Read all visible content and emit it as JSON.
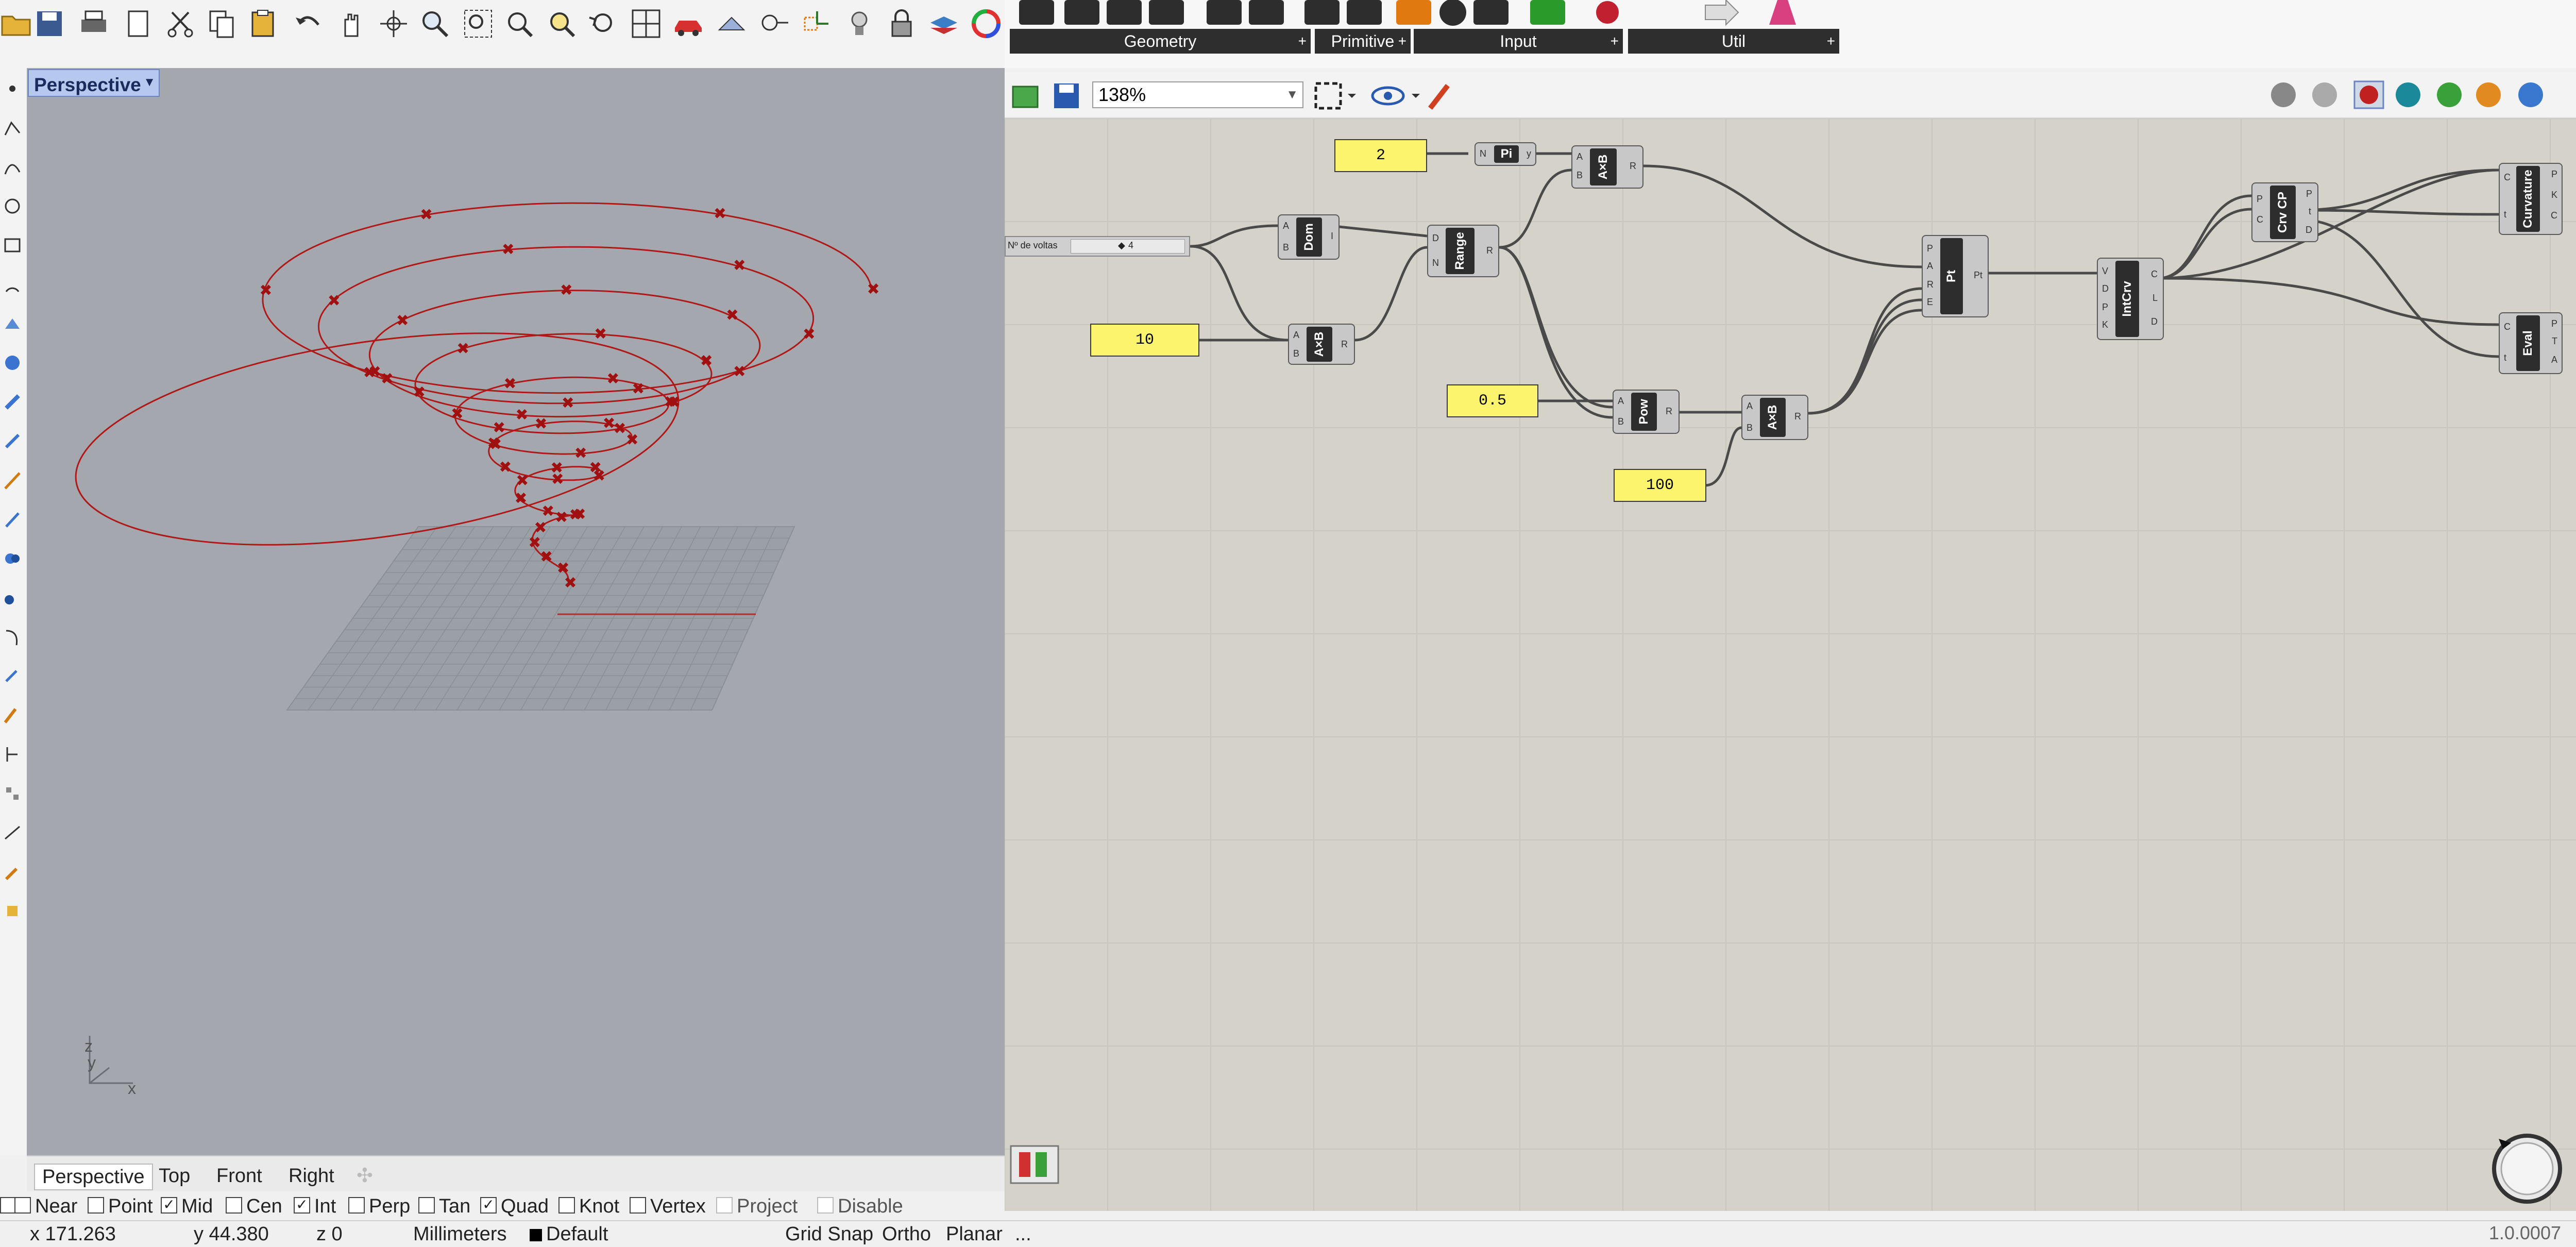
{
  "rhino": {
    "viewport": {
      "name": "Perspective",
      "axes": {
        "x": "x",
        "y": "y",
        "z": "z"
      }
    },
    "view_tabs": [
      {
        "label": "Perspective",
        "active": true
      },
      {
        "label": "Top"
      },
      {
        "label": "Front"
      },
      {
        "label": "Right"
      }
    ],
    "osnaps": [
      {
        "label": "Near",
        "checked": false
      },
      {
        "label": "Point",
        "checked": false
      },
      {
        "label": "Mid",
        "checked": true
      },
      {
        "label": "Cen",
        "checked": false
      },
      {
        "label": "Int",
        "checked": true
      },
      {
        "label": "Perp",
        "checked": false
      },
      {
        "label": "Tan",
        "checked": false
      },
      {
        "label": "Quad",
        "checked": true
      },
      {
        "label": "Knot",
        "checked": false
      },
      {
        "label": "Vertex",
        "checked": false
      },
      {
        "label": "Project",
        "checked": false
      },
      {
        "label": "Disable",
        "checked": false
      }
    ],
    "status": {
      "x": "x 171.263",
      "y": "y 44.380",
      "z": "z 0",
      "units": "Millimeters",
      "layer": "Default",
      "grid_snap": "Grid Snap",
      "ortho": "Ortho",
      "planar": "Planar"
    }
  },
  "grasshopper": {
    "ribbon_tabs": [
      "Geometry",
      "Primitive",
      "Input",
      "Util"
    ],
    "ribbon_tab_more": "+",
    "zoom": "138%",
    "canvas": {
      "slider": {
        "label": "Nº de voltas",
        "value": "4"
      },
      "panels": [
        "2",
        "10",
        "0.5",
        "100"
      ],
      "components": [
        {
          "name": "Pi",
          "inputs": [
            "N"
          ],
          "outputs": [
            "y"
          ]
        },
        {
          "name": "Dom",
          "inputs": [
            "A",
            "B"
          ],
          "outputs": [
            "I"
          ]
        },
        {
          "name": "Range",
          "inputs": [
            "D",
            "N"
          ],
          "outputs": [
            "R"
          ]
        },
        {
          "name": "A×B",
          "inputs": [
            "A",
            "B"
          ],
          "outputs": [
            "R"
          ]
        },
        {
          "name": "A×B",
          "inputs": [
            "A",
            "B"
          ],
          "outputs": [
            "R"
          ]
        },
        {
          "name": "Pow",
          "inputs": [
            "A",
            "B"
          ],
          "outputs": [
            "R"
          ]
        },
        {
          "name": "A×B",
          "inputs": [
            "A",
            "B"
          ],
          "outputs": [
            "R"
          ]
        },
        {
          "name": "Pt",
          "inputs": [
            "P",
            "A",
            "R",
            "E"
          ],
          "outputs": [
            "Pt"
          ]
        },
        {
          "name": "IntCrv",
          "inputs": [
            "V",
            "D",
            "P",
            "K"
          ],
          "outputs": [
            "C",
            "L",
            "D"
          ]
        },
        {
          "name": "Crv CP",
          "inputs": [
            "P",
            "C"
          ],
          "outputs": [
            "P",
            "t",
            "D"
          ]
        },
        {
          "name": "Curvature",
          "inputs": [
            "C",
            "t"
          ],
          "outputs": [
            "P",
            "K",
            "C"
          ]
        },
        {
          "name": "Eval",
          "inputs": [
            "C",
            "t"
          ],
          "outputs": [
            "P",
            "T",
            "A"
          ]
        }
      ]
    },
    "status_ellipsis": "...",
    "version": "1.0.0007"
  }
}
